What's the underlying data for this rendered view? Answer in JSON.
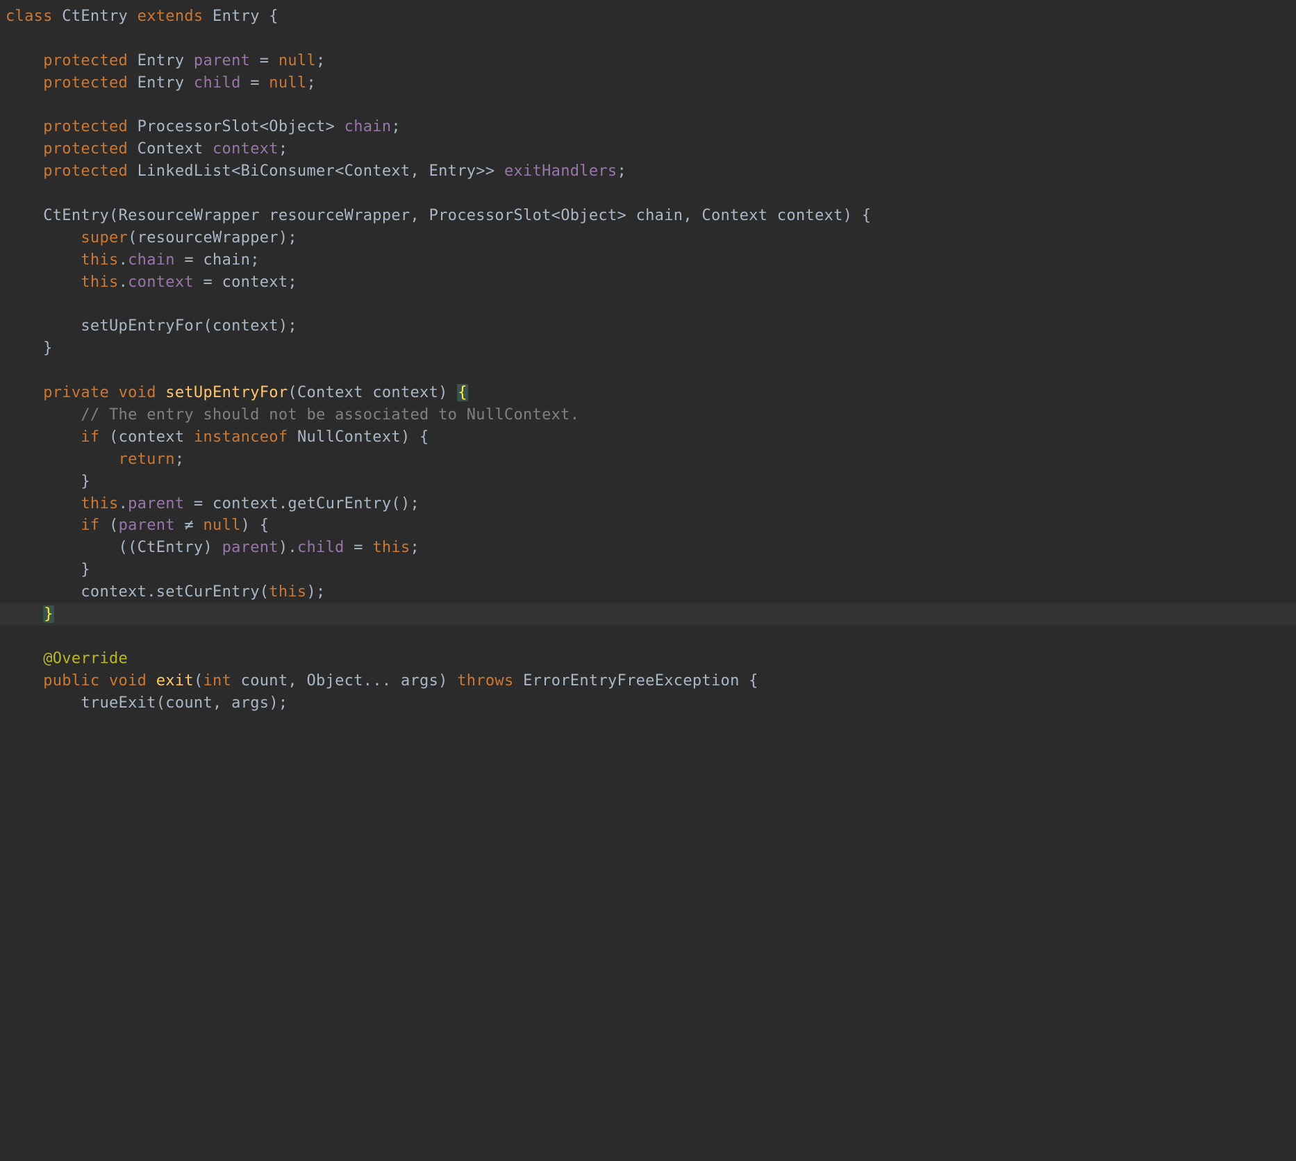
{
  "code": {
    "t": {
      "class": "class",
      "extends": "extends",
      "protected": "protected",
      "private": "private",
      "public": "public",
      "void": "void",
      "int": "int",
      "this": "this",
      "null": "null",
      "super": "super",
      "return": "return",
      "if": "if",
      "instanceof": "instanceof",
      "throws": "throws",
      "override": "@Override",
      "neq": "≠",
      "vararg": "..."
    },
    "cls": {
      "CtEntry": "CtEntry",
      "Entry": "Entry",
      "ProcessorSlot": "ProcessorSlot",
      "Object": "Object",
      "Context": "Context",
      "LinkedList": "LinkedList",
      "BiConsumer": "BiConsumer",
      "ResourceWrapper": "ResourceWrapper",
      "NullContext": "NullContext",
      "ErrorEntryFreeException": "ErrorEntryFreeException"
    },
    "fld": {
      "parent": "parent",
      "child": "child",
      "chain": "chain",
      "context": "context",
      "exitHandlers": "exitHandlers"
    },
    "mth": {
      "setUpEntryFor": "setUpEntryFor",
      "getCurEntry": "getCurEntry",
      "setCurEntry": "setCurEntry",
      "exit": "exit",
      "trueExit": "trueExit"
    },
    "var": {
      "resourceWrapper": "resourceWrapper",
      "chain": "chain",
      "context": "context",
      "count": "count",
      "args": "args"
    },
    "cmt": {
      "nullctx": "// The entry should not be associated to NullContext."
    }
  }
}
